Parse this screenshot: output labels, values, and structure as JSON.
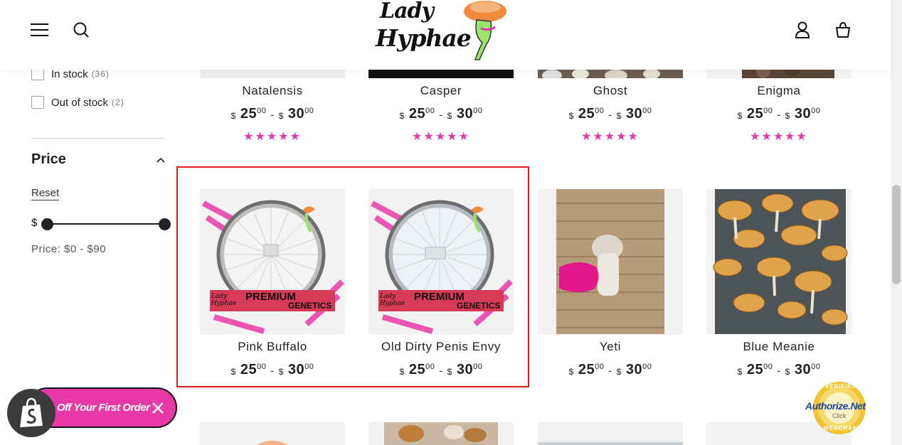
{
  "header": {
    "logo_line1": "Lady",
    "logo_line2": "Hyphae"
  },
  "filters": {
    "availability": [
      {
        "label": "In stock",
        "count": "(36)"
      },
      {
        "label": "Out of stock",
        "count": "(2)"
      }
    ],
    "price": {
      "title": "Price",
      "reset_label": "Reset",
      "currency_symbol": "$",
      "range_text": "Price: $0 - $90"
    }
  },
  "products_row1": [
    {
      "name": "Natalensis",
      "price_low": "25",
      "price_high": "30",
      "stars": "★★★★★"
    },
    {
      "name": "Casper",
      "price_low": "25",
      "price_high": "30",
      "stars": "★★★★★"
    },
    {
      "name": "Ghost",
      "price_low": "25",
      "price_high": "30",
      "stars": "★★★★★"
    },
    {
      "name": "Enigma",
      "price_low": "25",
      "price_high": "30",
      "stars": "★★★★★"
    }
  ],
  "products_row2": [
    {
      "name": "Pink Buffalo",
      "price_low": "25",
      "price_high": "30",
      "badge_top": "PREMIUM",
      "badge_bottom": "GENETICS",
      "badge_brand": "Lady Hyphae"
    },
    {
      "name": "Old Dirty Penis Envy",
      "price_low": "25",
      "price_high": "30",
      "badge_top": "PREMIUM",
      "badge_bottom": "GENETICS",
      "badge_brand": "Lady Hyphae"
    },
    {
      "name": "Yeti",
      "price_low": "25",
      "price_high": "30"
    },
    {
      "name": "Blue Meanie",
      "price_low": "25",
      "price_high": "30"
    }
  ],
  "price_format": {
    "currency": "$",
    "cents": "00",
    "separator": "-"
  },
  "promo": {
    "text": "Off Your First Order",
    "color": "#e73aa6"
  },
  "seal": {
    "top": "VERIFIED",
    "brand": "Authorize.Net",
    "click": "Click",
    "bottom": "MERCHANT"
  },
  "colors": {
    "accent_pink": "#e03aa8",
    "highlight_red": "#e21b1b"
  }
}
